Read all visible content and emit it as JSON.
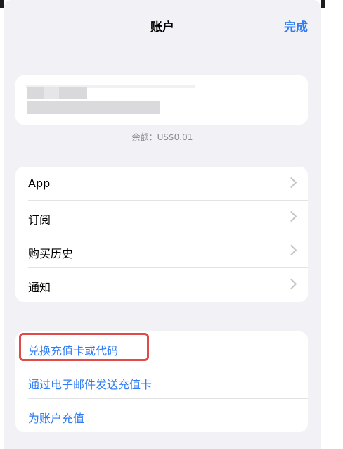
{
  "nav": {
    "title": "账户",
    "done_label": "完成"
  },
  "account": {
    "balance": "余额：US$0.01"
  },
  "menu_main": [
    {
      "label": "App"
    },
    {
      "label": "订阅"
    },
    {
      "label": "购买历史"
    },
    {
      "label": "通知"
    }
  ],
  "menu_gift": [
    {
      "label": "兑换充值卡或代码"
    },
    {
      "label": "通过电子邮件发送充值卡"
    },
    {
      "label": "为账户充值"
    }
  ],
  "colors": {
    "accent": "#2f7cf6",
    "highlight": "#e24a4a",
    "background": "#f2f2f6"
  }
}
